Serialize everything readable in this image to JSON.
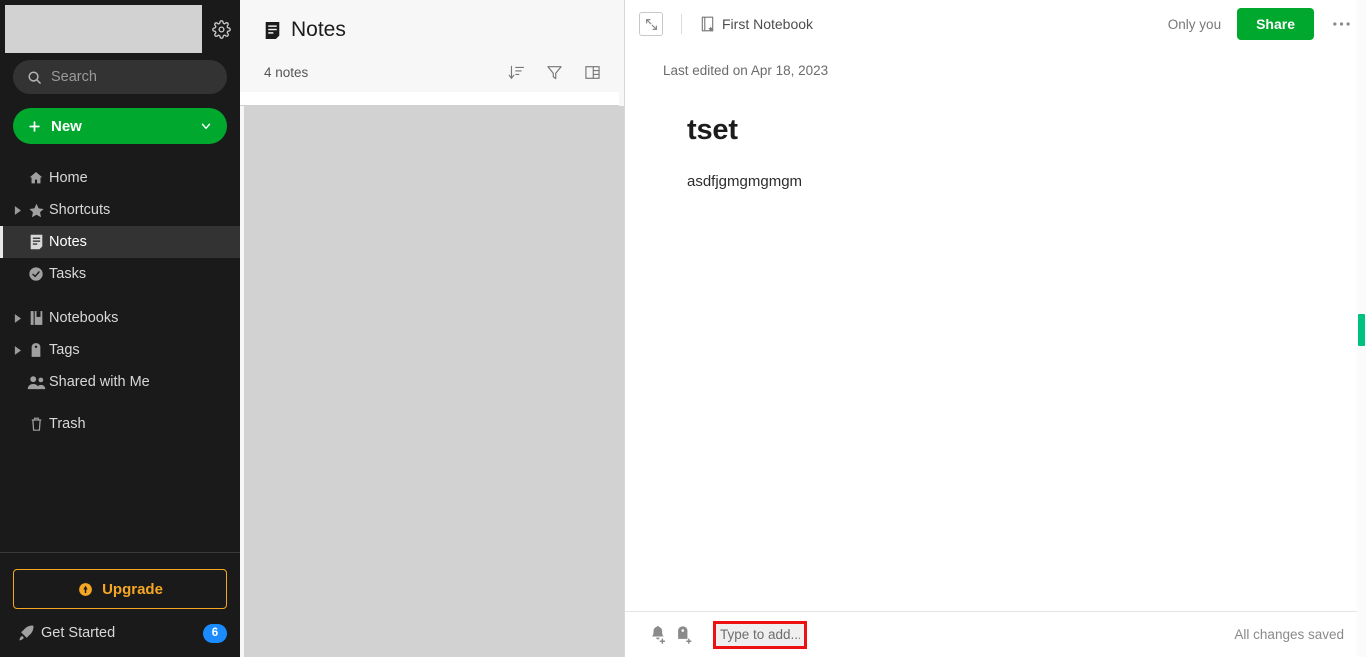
{
  "sidebar": {
    "profile": {
      "icon": "user-avatar-placeholder",
      "settings_icon": "gear-icon"
    },
    "search": {
      "placeholder": "Search",
      "icon": "search-icon"
    },
    "new_button": {
      "label": "New",
      "plus_icon": "plus-icon",
      "chevron_icon": "chevron-down-icon",
      "color": "#00a82d"
    },
    "items": [
      {
        "label": "Home",
        "icon": "home-icon",
        "twisty": false,
        "active": false
      },
      {
        "label": "Shortcuts",
        "icon": "star-icon",
        "twisty": true,
        "active": false
      },
      {
        "label": "Notes",
        "icon": "note-icon",
        "twisty": false,
        "active": true
      },
      {
        "label": "Tasks",
        "icon": "check-circle-icon",
        "twisty": false,
        "active": false
      },
      {
        "label": "Notebooks",
        "icon": "notebook-icon",
        "twisty": true,
        "active": false
      },
      {
        "label": "Tags",
        "icon": "tag-icon",
        "twisty": true,
        "active": false
      },
      {
        "label": "Shared with Me",
        "icon": "people-icon",
        "twisty": false,
        "active": false
      },
      {
        "label": "Trash",
        "icon": "trash-icon",
        "twisty": false,
        "active": false
      }
    ],
    "upgrade": {
      "label": "Upgrade",
      "icon": "upgrade-badge-icon",
      "color": "#f5a623"
    },
    "get_started": {
      "label": "Get Started",
      "icon": "rocket-icon",
      "badge": "6",
      "badge_color": "#1a8cff"
    }
  },
  "note_list": {
    "title": "Notes",
    "title_icon": "note-icon",
    "count": "4 notes",
    "tools": [
      {
        "name": "sort-icon",
        "label": "Sort"
      },
      {
        "name": "filter-icon",
        "label": "Filter"
      },
      {
        "name": "view-layout-icon",
        "label": "View options"
      }
    ]
  },
  "editor": {
    "expand_icon": "expand-collapse-icon",
    "notebook": {
      "label": "First Notebook",
      "icon": "notebook-star-icon"
    },
    "only_you": "Only you",
    "share_label": "Share",
    "share_color": "#00a82d",
    "more_icon": "more-horizontal-icon",
    "last_edited": "Last edited on Apr 18, 2023",
    "note_title": "tset",
    "note_body": "asdfjgmgmgmgm",
    "bottom": {
      "reminder_icon": "add-reminder-icon",
      "tag_icon": "add-tag-icon",
      "tag_input_value": "",
      "tag_input_placeholder": "Type to add...",
      "saved_status": "All changes saved",
      "highlight_color": "#ee1111"
    },
    "scrollbar_thumb_color": "#00c182"
  }
}
